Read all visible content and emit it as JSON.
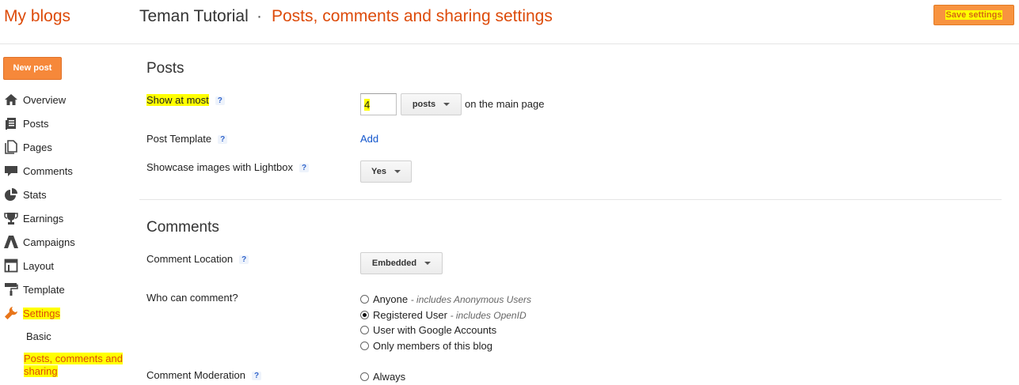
{
  "header": {
    "brand": "My blogs",
    "blog_title": "Teman Tutorial",
    "separator": "·",
    "page_title": "Posts, comments and sharing settings",
    "save_label": "Save settings"
  },
  "sidebar": {
    "new_post": "New post",
    "items": [
      {
        "label": "Overview",
        "icon": "home-icon"
      },
      {
        "label": "Posts",
        "icon": "posts-icon"
      },
      {
        "label": "Pages",
        "icon": "pages-icon"
      },
      {
        "label": "Comments",
        "icon": "comment-icon"
      },
      {
        "label": "Stats",
        "icon": "pie-chart-icon"
      },
      {
        "label": "Earnings",
        "icon": "trophy-icon"
      },
      {
        "label": "Campaigns",
        "icon": "adwords-icon"
      },
      {
        "label": "Layout",
        "icon": "layout-icon"
      },
      {
        "label": "Template",
        "icon": "paint-roller-icon"
      },
      {
        "label": "Settings",
        "icon": "wrench-icon"
      }
    ],
    "sub_items": {
      "basic": "Basic",
      "posts_comments": "Posts, comments and sharing"
    }
  },
  "posts": {
    "title": "Posts",
    "show_at_most_label": "Show at most",
    "show_at_most_value": "4",
    "show_unit": "posts",
    "show_suffix": "on the main page",
    "post_template_label": "Post Template",
    "post_template_action": "Add",
    "lightbox_label": "Showcase images with Lightbox",
    "lightbox_value": "Yes"
  },
  "comments": {
    "title": "Comments",
    "location_label": "Comment Location",
    "location_value": "Embedded",
    "who_label": "Who can comment?",
    "who_options": [
      {
        "label": "Anyone",
        "hint": "- includes Anonymous Users",
        "selected": false
      },
      {
        "label": "Registered User",
        "hint": "- includes OpenID",
        "selected": true
      },
      {
        "label": "User with Google Accounts",
        "hint": "",
        "selected": false
      },
      {
        "label": "Only members of this blog",
        "hint": "",
        "selected": false
      }
    ],
    "moderation_label": "Comment Moderation",
    "moderation_option": "Always"
  },
  "help_mark": "?",
  "colors": {
    "accent": "#dd4b0a",
    "button": "#f8933f",
    "highlight": "#ffff00",
    "link": "#1155cc"
  }
}
